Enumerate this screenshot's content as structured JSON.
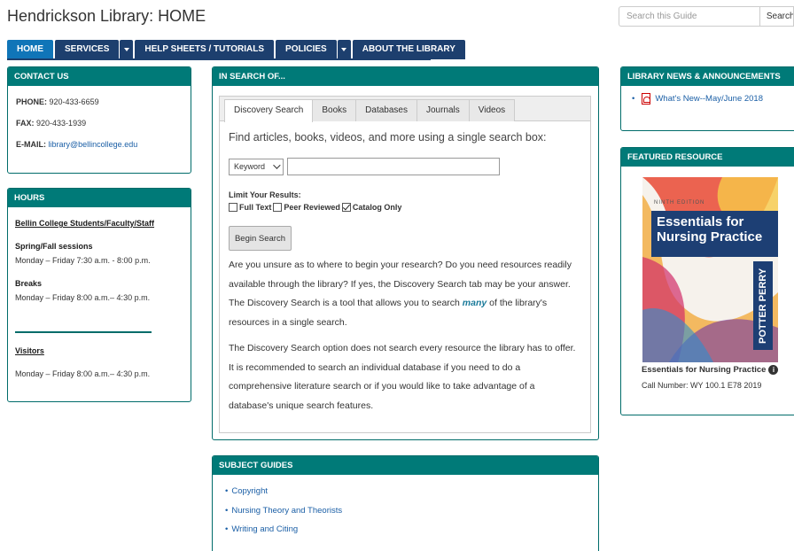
{
  "header": {
    "title": "Hendrickson Library: HOME",
    "search_placeholder": "Search this Guide",
    "search_button": "Search"
  },
  "nav": {
    "items": [
      {
        "label": "HOME",
        "active": true
      },
      {
        "label": "SERVICES",
        "dropdown": true
      },
      {
        "label": "HELP SHEETS / TUTORIALS"
      },
      {
        "label": "POLICIES",
        "dropdown": true
      },
      {
        "label": "ABOUT THE LIBRARY"
      }
    ]
  },
  "contact": {
    "title": "CONTACT US",
    "phone_label": "PHONE:",
    "phone": "920-433-6659",
    "fax_label": "FAX:",
    "fax": "920-433-1939",
    "email_label": "E-MAIL:",
    "email": "library@bellincollege.edu"
  },
  "hours": {
    "title": "HOURS",
    "group1": "Bellin College Students/Faculty/Staff",
    "spring_label": "Spring/Fall sessions",
    "spring_hours": "Monday – Friday 7:30 a.m. - 8:00 p.m.",
    "breaks_label": "Breaks",
    "breaks_hours": "Monday – Friday 8:00 a.m.– 4:30 p.m.",
    "visitors_label": "Visitors",
    "visitors_hours": "Monday – Friday 8:00 a.m.– 4:30 p.m."
  },
  "search": {
    "title": "IN SEARCH OF...",
    "tabs": [
      "Discovery Search",
      "Books",
      "Databases",
      "Journals",
      "Videos"
    ],
    "intro": "Find articles, books, videos, and more using a single search box:",
    "select_value": "Keyword",
    "limit_title": "Limit Your Results:",
    "checks": [
      {
        "label": "Full Text",
        "checked": false
      },
      {
        "label": "Peer Reviewed",
        "checked": false
      },
      {
        "label": "Catalog Only",
        "checked": true
      }
    ],
    "button": "Begin Search",
    "para1_a": "Are you unsure as to where to begin your research?  Do you need resources readily available through the library?  If yes, the Discovery Search tab may be your answer.  The Discovery Search is a tool that allows you to search ",
    "para1_em": "many",
    "para1_b": " of the library's resources in a single search.",
    "para2": "The Discovery Search option does not search every resource the library has to offer.  It is recommended to search an individual database if you need to do a comprehensive literature search or if you would like to take advantage of a database's unique search features."
  },
  "subject": {
    "title": "SUBJECT GUIDES",
    "items": [
      "Copyright",
      "Nursing Theory and Theorists",
      "Writing and Citing"
    ]
  },
  "news": {
    "title": "LIBRARY NEWS & ANNOUNCEMENTS",
    "item": "What's New--May/June 2018"
  },
  "featured": {
    "title": "FEATURED RESOURCE",
    "edition": "NINTH EDITION",
    "cover_line1": "Essentials for",
    "cover_line2": "Nursing Practice",
    "authors": "POTTER PERRY",
    "name": "Essentials for Nursing Practice",
    "call_number": "Call Number: WY 100.1 E78 2019"
  },
  "colors": {
    "teal": "#007a78",
    "nav_blue": "#1d3f6e",
    "nav_active": "#1075b8",
    "link": "#1b5fa6"
  }
}
